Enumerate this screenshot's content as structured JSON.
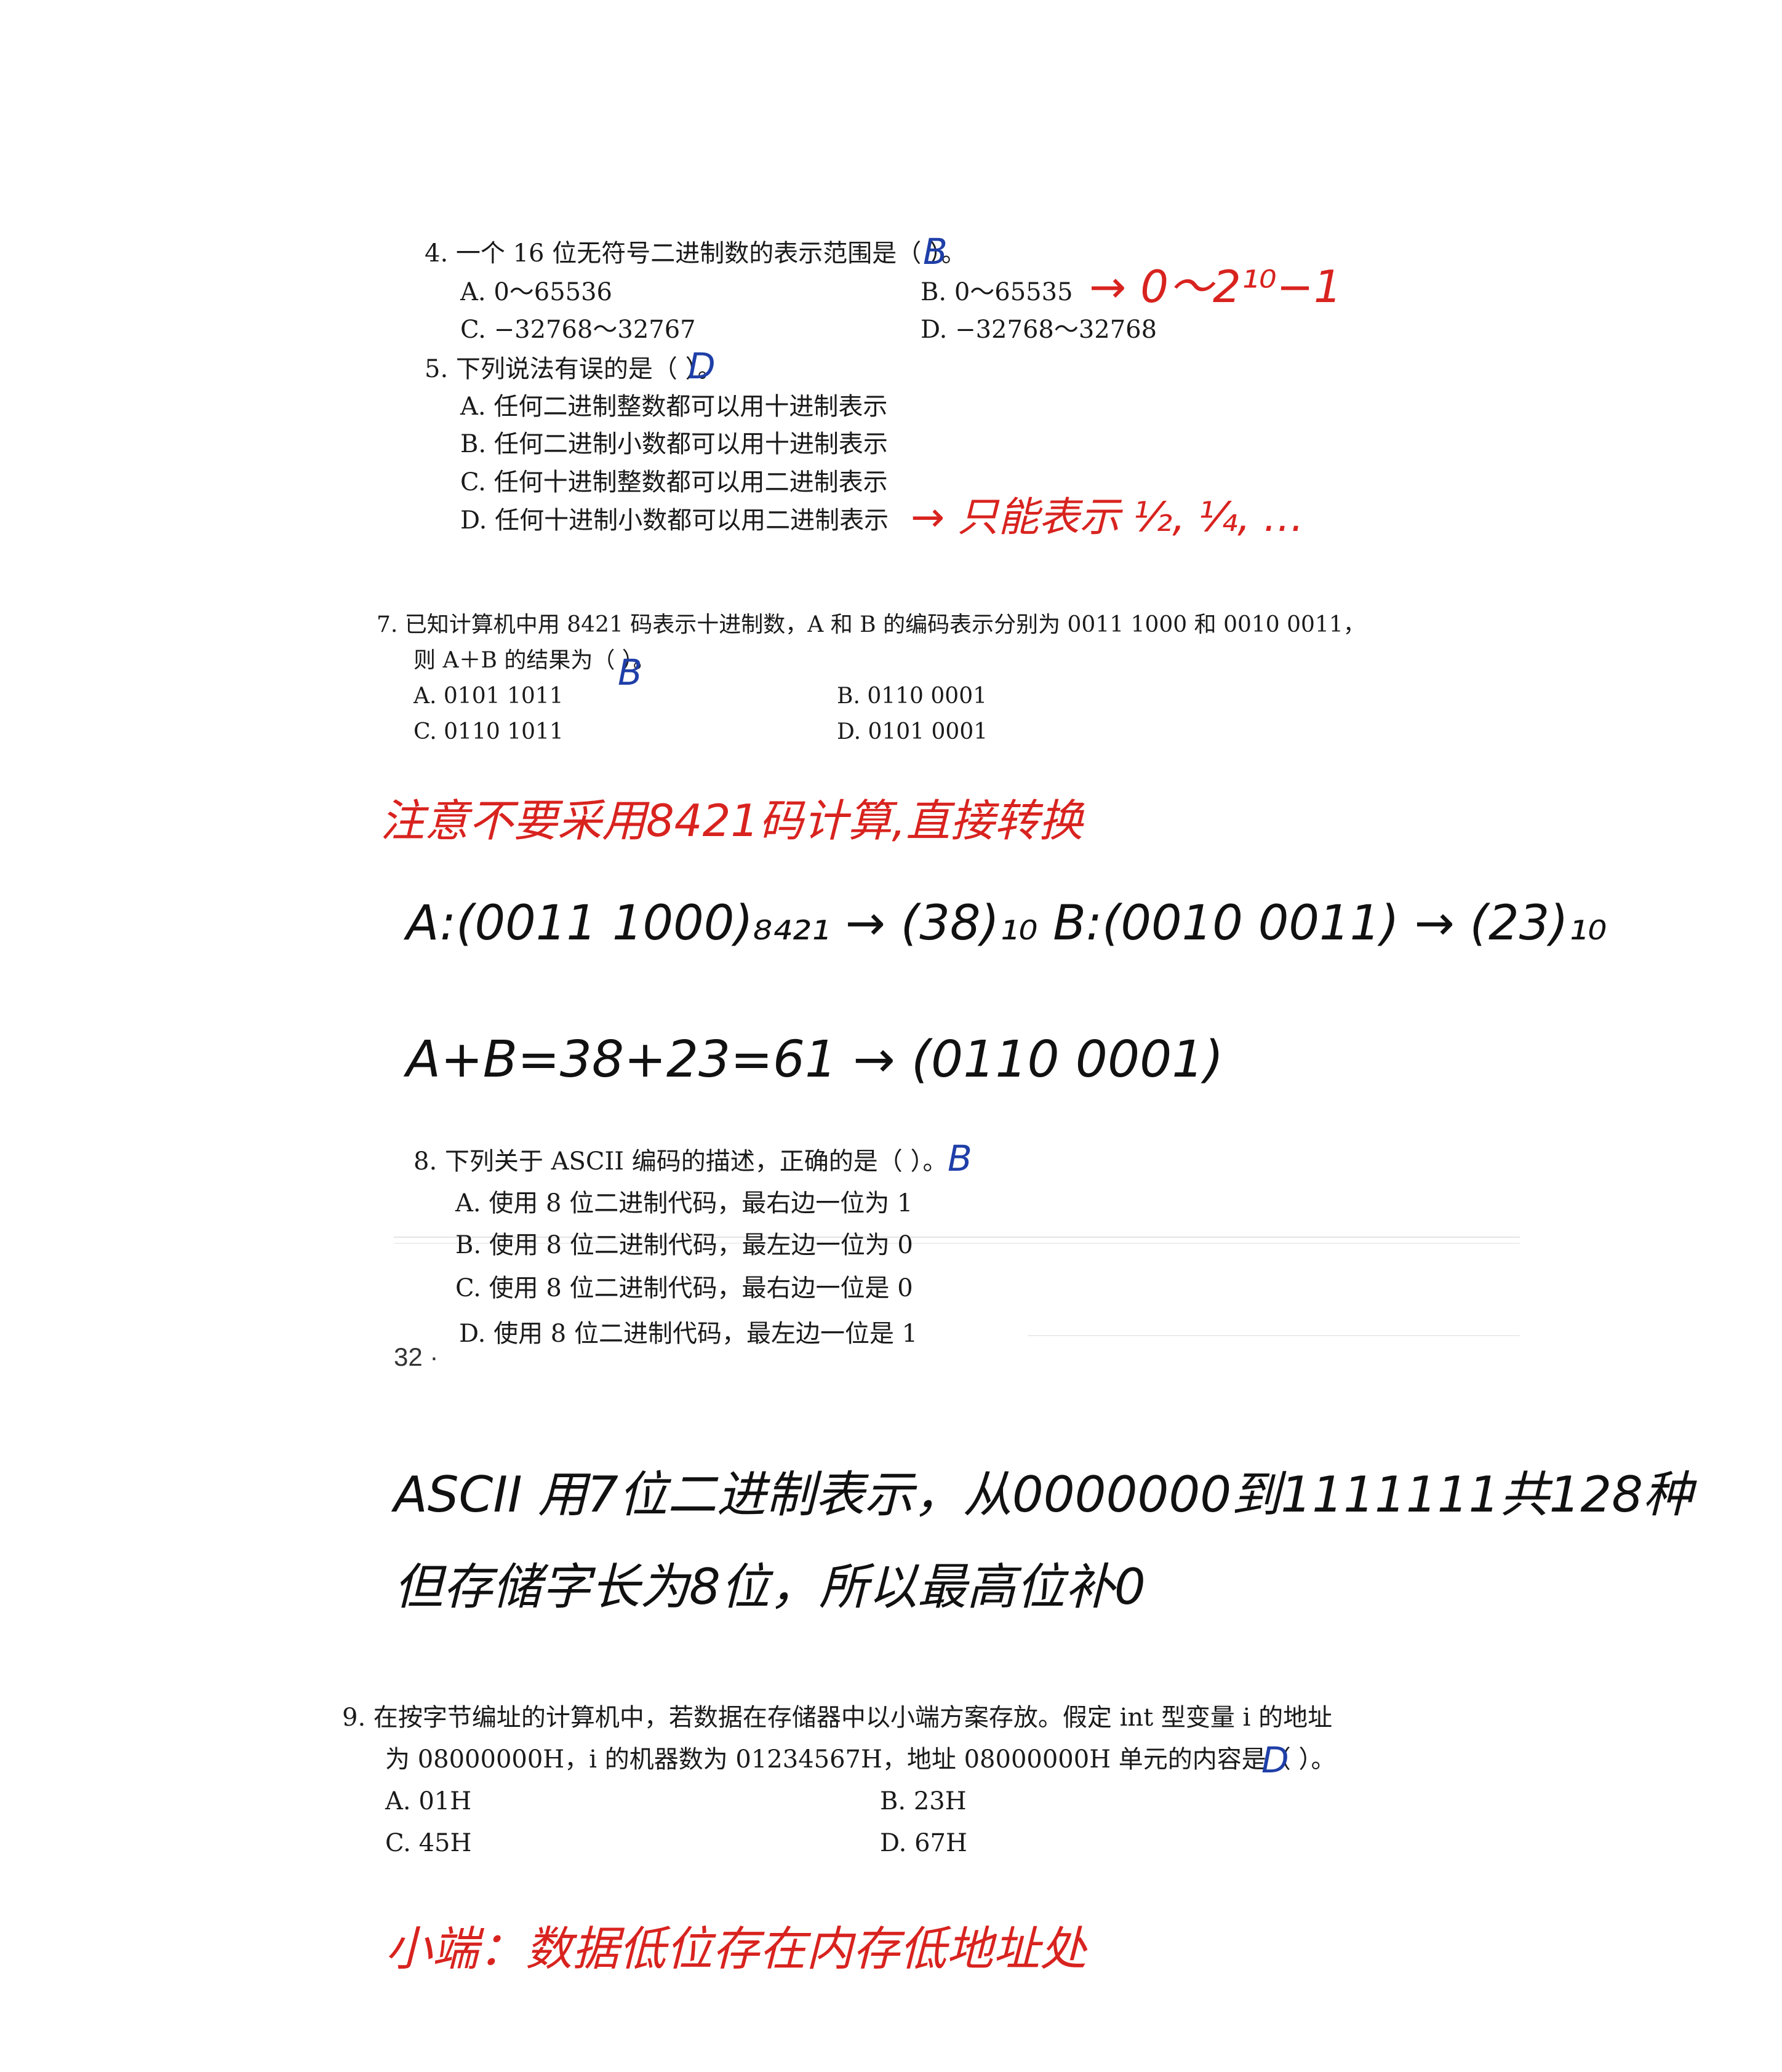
{
  "q4": {
    "stem": "4.  一个 16 位无符号二进制数的表示范围是（   ）。",
    "answer": "B",
    "options": [
      "A.  0～65536",
      "B.  0～65535",
      "C.  −32768～32767",
      "D.  −32768～32768"
    ],
    "note": "→ 0～2¹⁰−1"
  },
  "q5": {
    "stem": "5.  下列说法有误的是（   ）。",
    "answer": "D",
    "options": [
      "A.  任何二进制整数都可以用十进制表示",
      "B.  任何二进制小数都可以用十进制表示",
      "C.  任何十进制整数都可以用二进制表示",
      "D.  任何十进制小数都可以用二进制表示"
    ],
    "note": "→ 只能表示 ½, ¼, …"
  },
  "q7": {
    "stem1": "7. 已知计算机中用 8421 码表示十进制数，A 和 B 的编码表示分别为 0011 1000 和 0010 0011，",
    "stem2": "则 A＋B 的结果为（   ）。",
    "answer": "B",
    "options": [
      "A.  0101 1011",
      "B.  0110 0001",
      "C.  0110 1011",
      "D.  0101 0001"
    ],
    "note_red": "注意不要采用8421码计算,直接转换",
    "work1": "A:(0011 1000)₈₄₂₁ → (38)₁₀    B:(0010 0011) → (23)₁₀",
    "work2": "A+B=38+23=61 → (0110 0001)"
  },
  "q8": {
    "stem": "8.  下列关于 ASCII 编码的描述，正确的是（   ）。",
    "answer": "B",
    "options": [
      "A.  使用 8 位二进制代码，最右边一位为 1",
      "B.  使用 8 位二进制代码，最左边一位为 0",
      "C.  使用 8 位二进制代码，最右边一位是 0",
      "D.  使用 8 位二进制代码，最左边一位是 1"
    ],
    "page_number": "32 ·",
    "work1": "ASCII 用7位二进制表示，从0000000到1111111共128种",
    "work2": "但存储字长为8位，所以最高位补0"
  },
  "q9": {
    "stem1": "9.  在按字节编址的计算机中，若数据在存储器中以小端方案存放。假定 int 型变量 i 的地址",
    "stem2": "为 08000000H，i 的机器数为 01234567H，地址 08000000H 单元的内容是（   ）。",
    "answer": "D",
    "options": [
      "A.  01H",
      "B.  23H",
      "C.  45H",
      "D.  67H"
    ],
    "note_red": "小端：数据低位存在内存低地址处"
  }
}
